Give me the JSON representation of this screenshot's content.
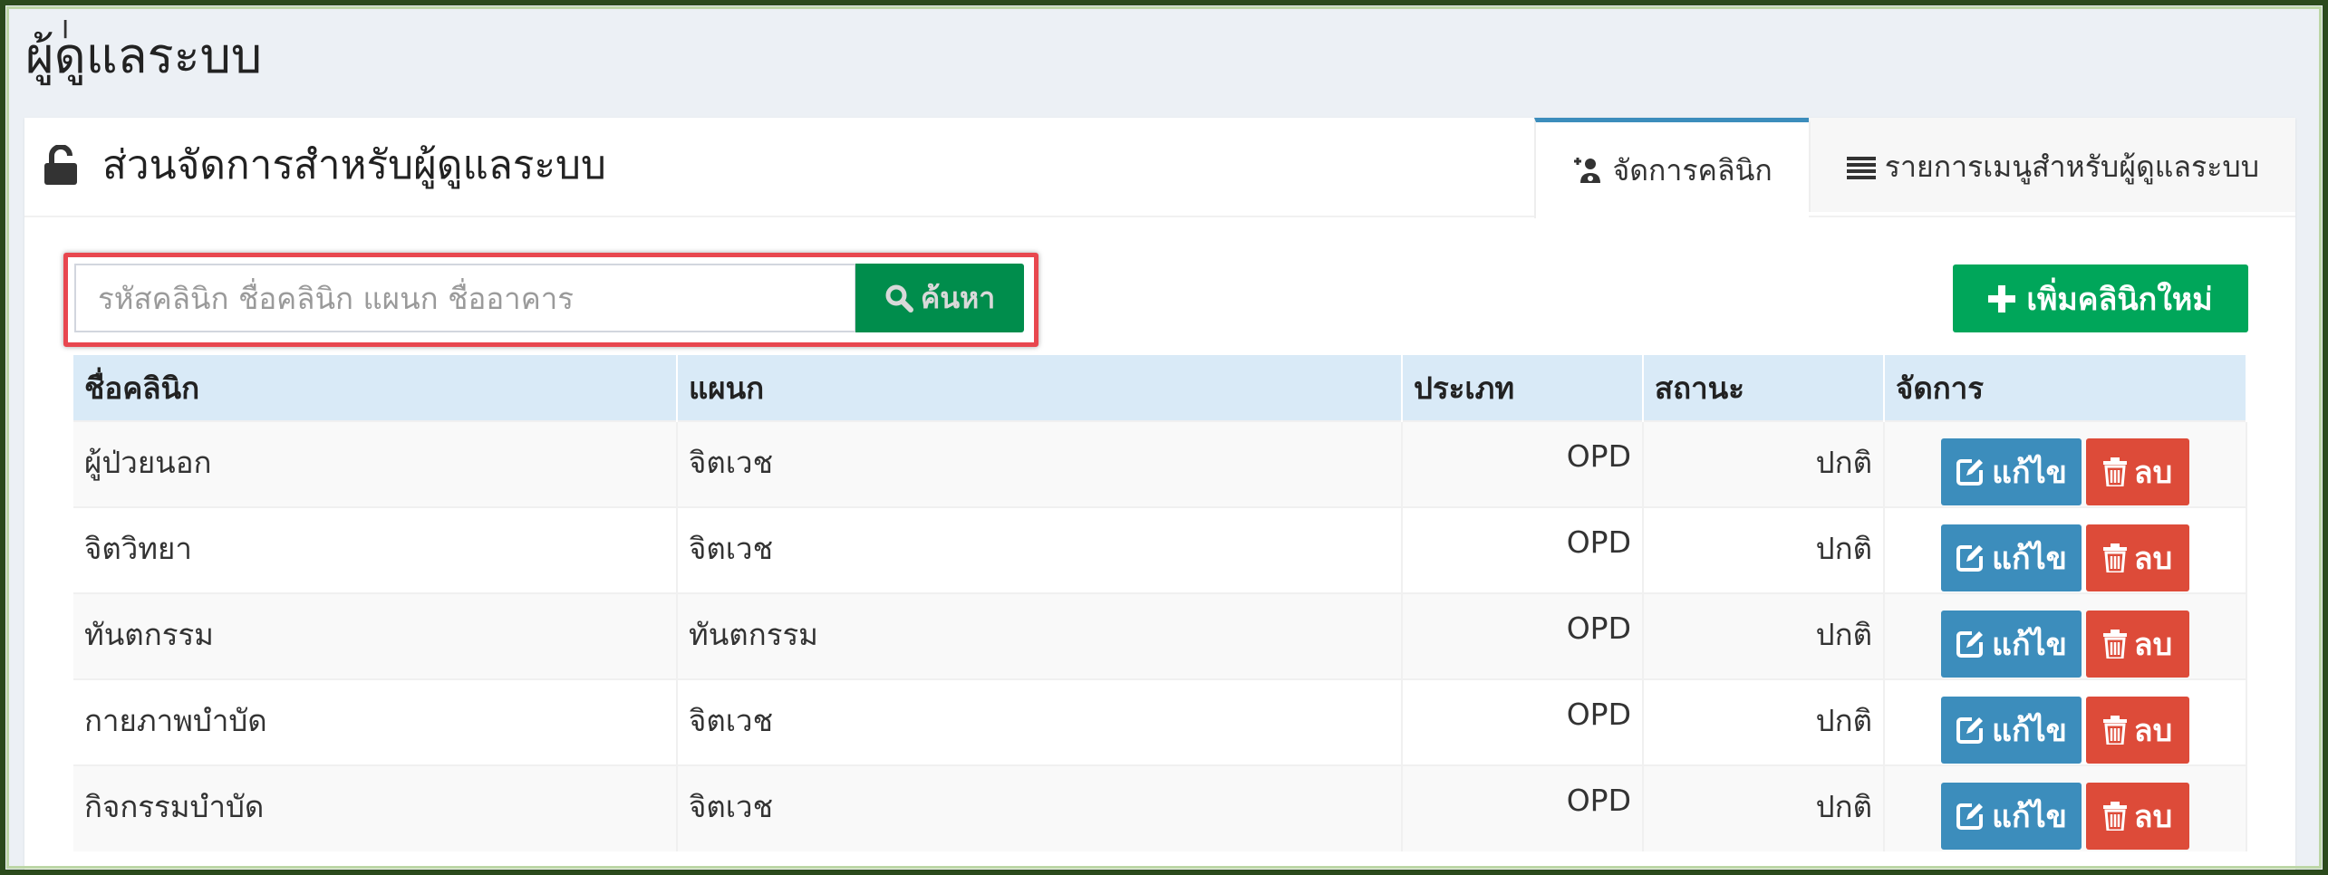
{
  "page": {
    "title": "ผู้ดูแลระบบ",
    "accent_color": "#3c8dbc"
  },
  "box": {
    "title": "ส่วนจัดการสำหรับผู้ดูแลระบบ",
    "title_icon": "unlock-icon"
  },
  "tabs": [
    {
      "label": "จัดการคลินิก",
      "icon": "user-group-plus-icon",
      "active": true
    },
    {
      "label": "รายการเมนูสำหรับผู้ดูแลระบบ",
      "icon": "list-icon",
      "active": false
    }
  ],
  "search": {
    "placeholder": "รหัสคลินิก ชื่อคลินิก แผนก ชื่ออาคาร",
    "value": "",
    "button_label": "ค้นหา",
    "button_icon": "search-icon",
    "highlight_color": "#e8474f"
  },
  "add_button": {
    "label": "เพิ่มคลินิกใหม่",
    "icon": "plus-icon",
    "color": "#00a65a"
  },
  "table": {
    "headers": {
      "name": "ชื่อคลินิก",
      "department": "แผนก",
      "type": "ประเภท",
      "status": "สถานะ",
      "actions": "จัดการ"
    },
    "edit_label": "แก้ไข",
    "delete_label": "ลบ",
    "edit_color": "#3c8dbc",
    "delete_color": "#dd4b39",
    "rows": [
      {
        "name": "ผู้ป่วยนอก",
        "department": "จิตเวช",
        "type": "OPD",
        "status": "ปกติ"
      },
      {
        "name": "จิตวิทยา",
        "department": "จิตเวช",
        "type": "OPD",
        "status": "ปกติ"
      },
      {
        "name": "ทันตกรรม",
        "department": "ทันตกรรม",
        "type": "OPD",
        "status": "ปกติ"
      },
      {
        "name": "กายภาพบำบัด",
        "department": "จิตเวช",
        "type": "OPD",
        "status": "ปกติ"
      },
      {
        "name": "กิจกรรมบำบัด",
        "department": "จิตเวช",
        "type": "OPD",
        "status": "ปกติ"
      }
    ]
  }
}
